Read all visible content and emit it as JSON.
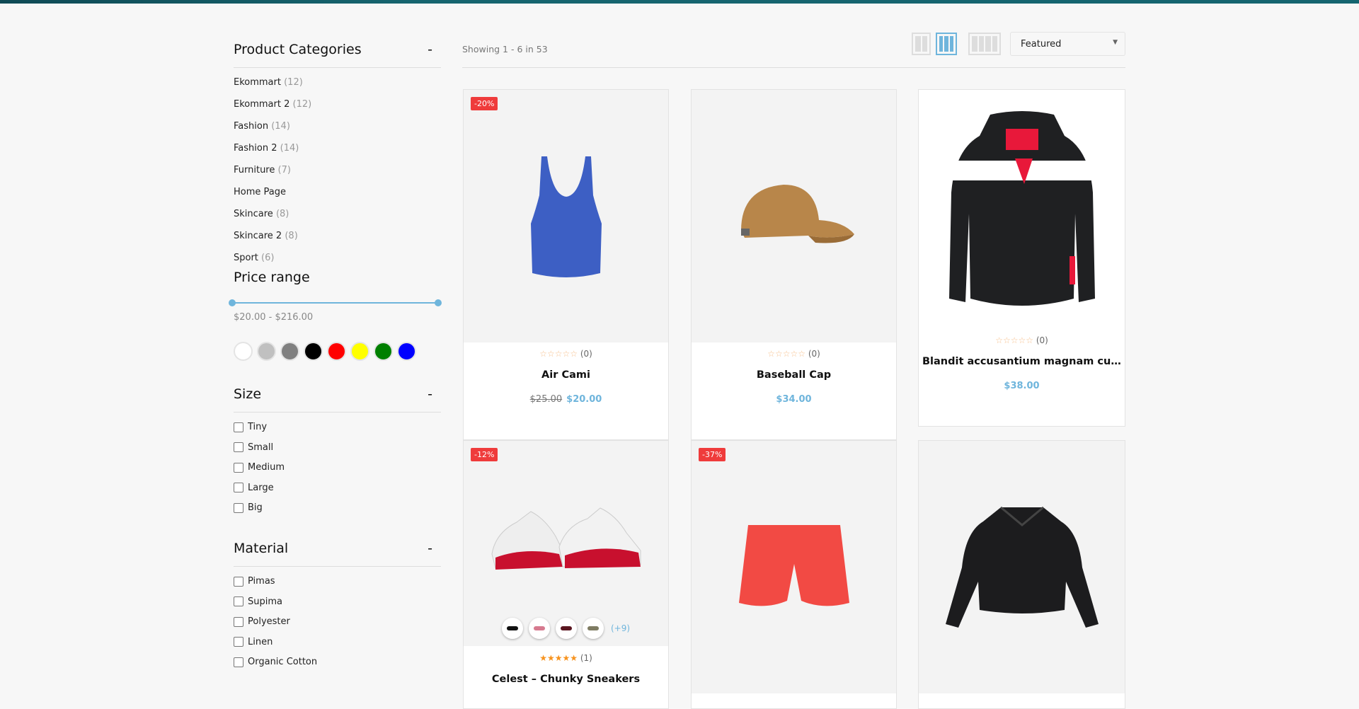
{
  "sidebar": {
    "categories_title": "Product Categories",
    "collapse_symbol": "-",
    "categories": [
      {
        "name": "Ekommart",
        "count": "(12)"
      },
      {
        "name": "Ekommart 2",
        "count": "(12)"
      },
      {
        "name": "Fashion",
        "count": "(14)"
      },
      {
        "name": "Fashion 2",
        "count": "(14)"
      },
      {
        "name": "Furniture",
        "count": "(7)"
      },
      {
        "name": "Home Page",
        "count": ""
      },
      {
        "name": "Skincare",
        "count": "(8)"
      },
      {
        "name": "Skincare 2",
        "count": "(8)"
      },
      {
        "name": "Sport",
        "count": "(6)"
      }
    ],
    "price_title": "Price range",
    "price_text": "$20.00 - $216.00",
    "price_min": 20,
    "price_max": 216,
    "colors": [
      "#ffffff",
      "#c0c0c0",
      "#808080",
      "#000000",
      "#ff0000",
      "#ffff00",
      "#008000",
      "#0000ff"
    ],
    "size_title": "Size",
    "sizes": [
      "Tiny",
      "Small",
      "Medium",
      "Large",
      "Big"
    ],
    "material_title": "Material",
    "materials": [
      "Pimas",
      "Supima",
      "Polyester",
      "Linen",
      "Organic Cotton"
    ]
  },
  "toolbar": {
    "showing": "Showing 1 - 6 in 53",
    "sort_value": "Featured",
    "active_view": "3-columns",
    "accent": "#6fb5dc"
  },
  "products": [
    {
      "name": "Air Cami",
      "badge": "-20%",
      "stars": "☆☆☆☆☆",
      "reviews": "(0)",
      "old_price": "$25.00",
      "price": "$20.00"
    },
    {
      "name": "Baseball Cap",
      "stars": "☆☆☆☆☆",
      "reviews": "(0)",
      "price": "$34.00"
    },
    {
      "name": "Blandit accusantium magnam cura...",
      "stars": "☆☆☆☆☆",
      "reviews": "(0)",
      "price": "$38.00"
    },
    {
      "name": "Celest – Chunky Sneakers",
      "badge": "-12%",
      "stars": "★★★★★",
      "reviews": "(1)",
      "more_variants": "(+9)"
    },
    {
      "name": "",
      "badge": "-37%"
    },
    {
      "name": ""
    }
  ],
  "badge_color": "#ef3b3b"
}
